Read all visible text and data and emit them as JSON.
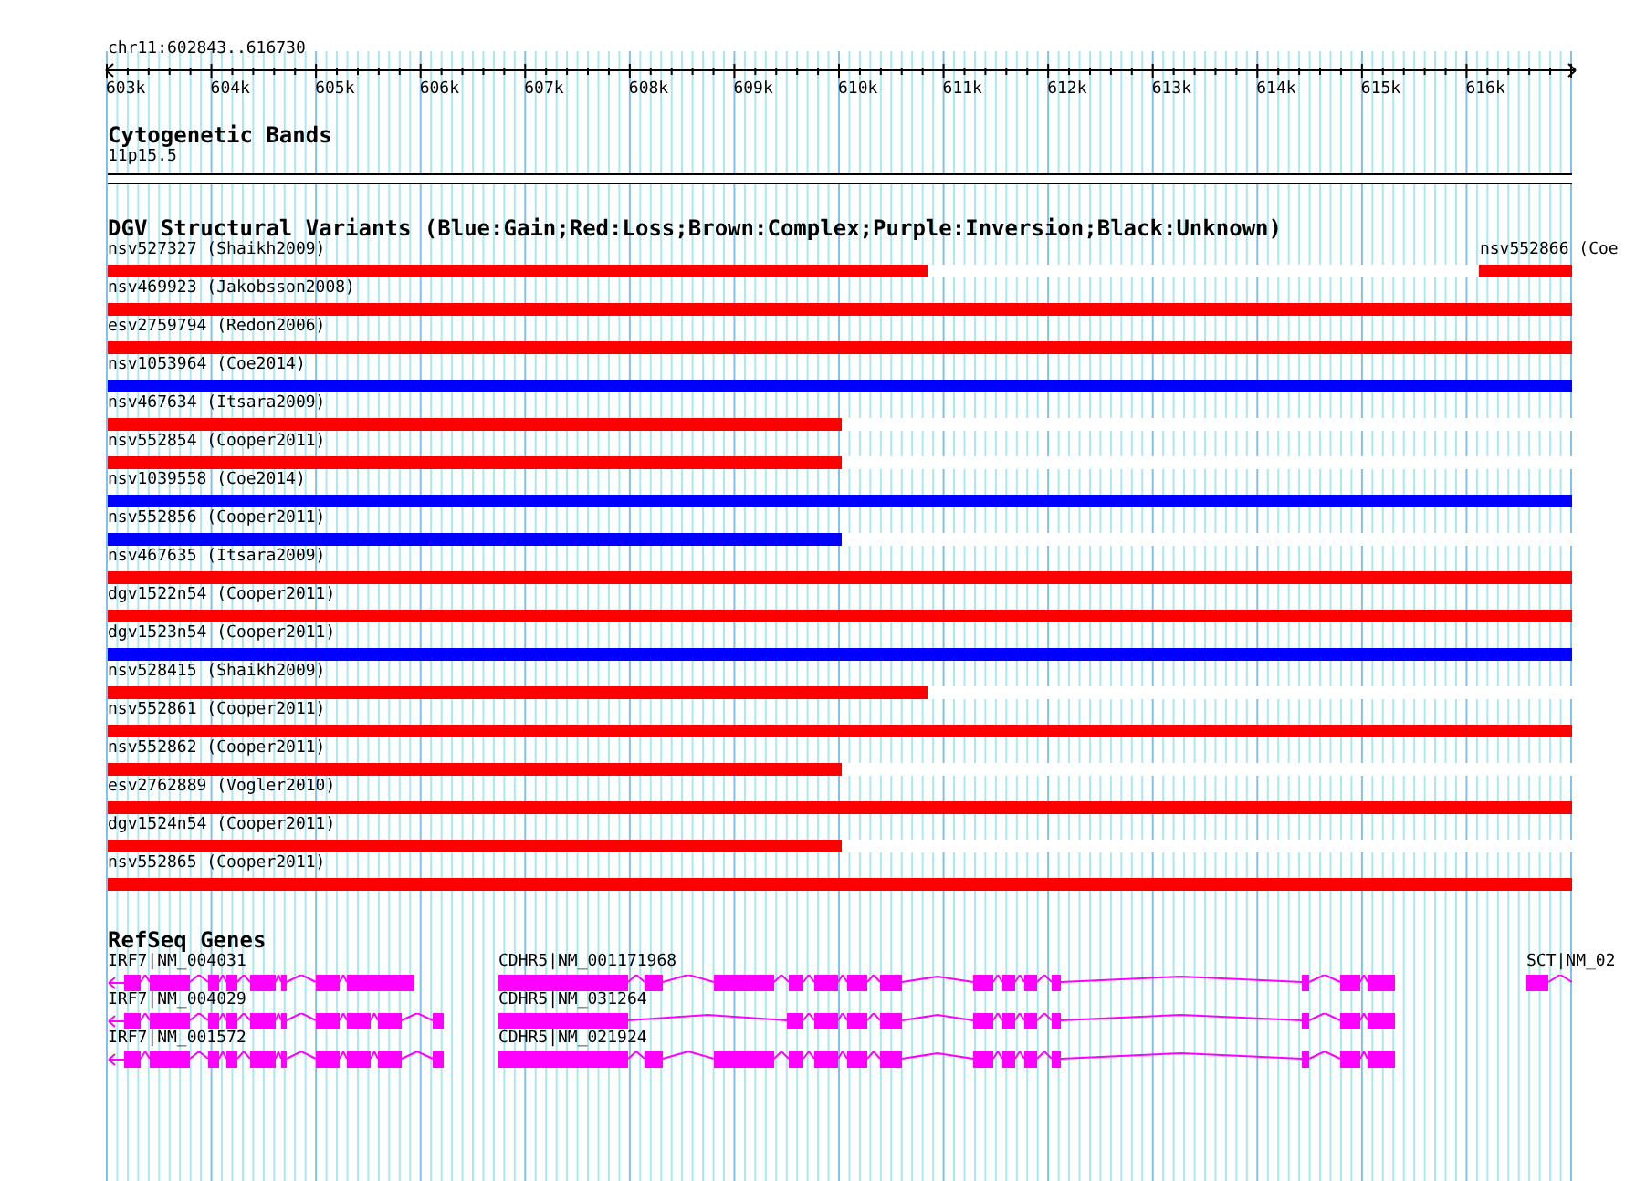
{
  "ruler": {
    "region": "chr11:602843..616730",
    "ticks": [
      "603k",
      "604k",
      "605k",
      "606k",
      "607k",
      "608k",
      "609k",
      "610k",
      "611k",
      "612k",
      "613k",
      "614k",
      "615k",
      "616k"
    ]
  },
  "cytogenetic_bands": {
    "title": "Cytogenetic Bands",
    "band": "11p15.5"
  },
  "dgv": {
    "title": "DGV Structural Variants (Blue:Gain;Red:Loss;Brown:Complex;Purple:Inversion;Black:Unknown)",
    "rows": [
      [
        {
          "label": "nsv527327 (Shaikh2009)",
          "color": "#ff0000",
          "level": 0.56,
          "kind": "left"
        },
        {
          "label": "nsv552866 (Coe",
          "color": "#ff0000",
          "level": 0.063,
          "kind": "right"
        }
      ],
      [
        {
          "label": "nsv469923 (Jakobsson2008)",
          "color": "#ff0000",
          "level": 1,
          "kind": "left"
        }
      ],
      [
        {
          "label": "esv2759794 (Redon2006)",
          "color": "#ff0000",
          "level": 1,
          "kind": "left"
        }
      ],
      [
        {
          "label": "nsv1053964 (Coe2014)",
          "color": "#0000ff",
          "level": 1,
          "kind": "left"
        }
      ],
      [
        {
          "label": "nsv467634 (Itsara2009)",
          "color": "#ff0000",
          "level": 0.501,
          "kind": "left"
        }
      ],
      [
        {
          "label": "nsv552854 (Cooper2011)",
          "color": "#ff0000",
          "level": 0.501,
          "kind": "left"
        }
      ],
      [
        {
          "label": "nsv1039558 (Coe2014)",
          "color": "#0000ff",
          "level": 1,
          "kind": "left"
        }
      ],
      [
        {
          "label": "nsv552856 (Cooper2011)",
          "color": "#0000ff",
          "level": 0.501,
          "kind": "left"
        }
      ],
      [
        {
          "label": "nsv467635 (Itsara2009)",
          "color": "#ff0000",
          "level": 1,
          "kind": "left"
        }
      ],
      [
        {
          "label": "dgv1522n54 (Cooper2011)",
          "color": "#ff0000",
          "level": 1,
          "kind": "left"
        }
      ],
      [
        {
          "label": "dgv1523n54 (Cooper2011)",
          "color": "#0000ff",
          "level": 1,
          "kind": "left"
        }
      ],
      [
        {
          "label": "nsv528415 (Shaikh2009)",
          "color": "#ff0000",
          "level": 0.56,
          "kind": "left"
        }
      ],
      [
        {
          "label": "nsv552861 (Cooper2011)",
          "color": "#ff0000",
          "level": 1,
          "kind": "left"
        }
      ],
      [
        {
          "label": "nsv552862 (Cooper2011)",
          "color": "#ff0000",
          "level": 0.501,
          "kind": "left"
        }
      ],
      [
        {
          "label": "esv2762889 (Vogler2010)",
          "color": "#ff0000",
          "level": 1,
          "kind": "left"
        }
      ],
      [
        {
          "label": "dgv1524n54 (Cooper2011)",
          "color": "#ff0000",
          "level": 0.501,
          "kind": "left"
        }
      ],
      [
        {
          "label": "nsv552865 (Cooper2011)",
          "color": "#ff0000",
          "level": 1,
          "kind": "left"
        }
      ]
    ]
  },
  "refseq": {
    "title": "RefSeq Genes",
    "rows": [
      [
        {
          "label": "IRF7|NM_004031"
        },
        {
          "label": "CDHR5|NM_001171968"
        },
        {
          "label": "SCT|NM_02"
        }
      ],
      [
        {
          "label": "IRF7|NM_004029"
        },
        {
          "label": "CDHR5|NM_031264"
        }
      ],
      [
        {
          "label": "IRF7|NM_001572"
        },
        {
          "label": "CDHR5|NM_021924"
        }
      ]
    ]
  }
}
